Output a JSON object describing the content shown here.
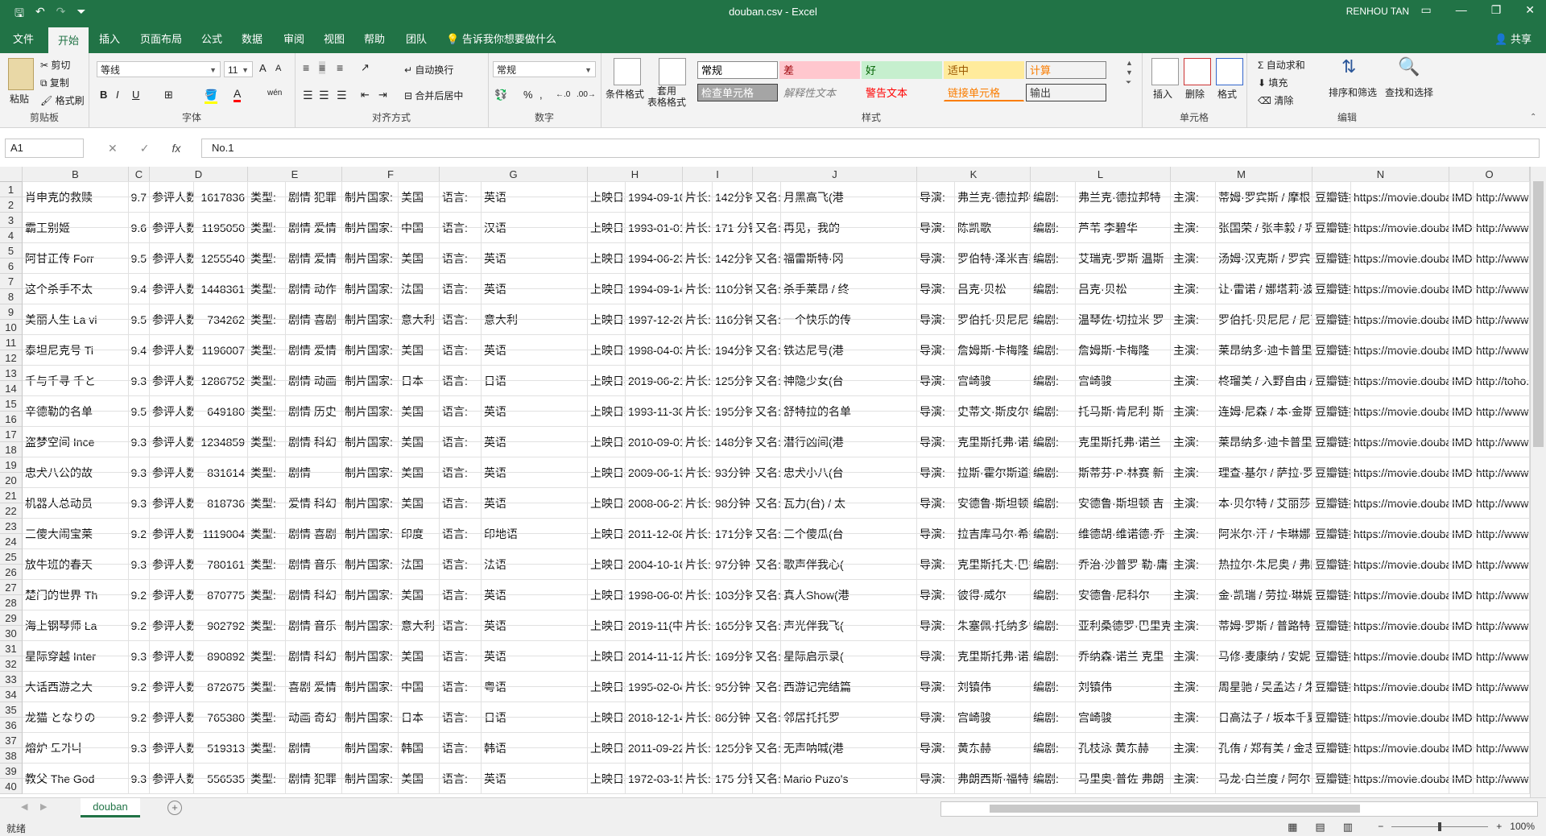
{
  "window": {
    "title": "douban.csv - Excel",
    "user": "RENHOU TAN",
    "share_label": "共享",
    "qat": {
      "save_icon": "save-icon",
      "undo_icon": "undo-icon",
      "redo_icon": "redo-icon",
      "customize_icon": "customize-icon"
    }
  },
  "tabs": [
    "文件",
    "开始",
    "插入",
    "页面布局",
    "公式",
    "数据",
    "审阅",
    "视图",
    "帮助",
    "团队"
  ],
  "active_tab": "开始",
  "tell_me": "告诉我你想要做什么",
  "ribbon": {
    "clipboard": {
      "paste": "粘贴",
      "cut": "剪切",
      "copy": "复制",
      "format_painter": "格式刷",
      "label": "剪贴板"
    },
    "font": {
      "name": "等线",
      "size": "11",
      "bold": "B",
      "italic": "I",
      "underline": "U",
      "grow": "A",
      "shrink": "A",
      "font_color": "A",
      "phonetic": "wén",
      "label": "字体"
    },
    "alignment": {
      "wrap": "自动换行",
      "merge": "合并后居中",
      "label": "对齐方式"
    },
    "number": {
      "format": "常规",
      "percent": "%",
      "comma": ",",
      "label": "数字"
    },
    "styles": {
      "conditional": "条件格式",
      "table": "套用\n表格格式",
      "cells": [
        {
          "text": "常规",
          "bg": "#ffffff",
          "color": "#000000",
          "border": "#888888"
        },
        {
          "text": "差",
          "bg": "#ffc7ce",
          "color": "#9c0006",
          "border": "#ffc7ce"
        },
        {
          "text": "好",
          "bg": "#c6efce",
          "color": "#006100",
          "border": "#c6efce"
        },
        {
          "text": "适中",
          "bg": "#ffeb9c",
          "color": "#9c5700",
          "border": "#ffeb9c"
        },
        {
          "text": "计算",
          "bg": "#f2f2f2",
          "color": "#fa7d00",
          "border": "#7f7f7f"
        },
        {
          "text": "检查单元格",
          "bg": "#a5a5a5",
          "color": "#ffffff",
          "border": "#3f3f3f"
        },
        {
          "text": "解释性文本",
          "bg": "#f3f3f3",
          "color": "#7f7f7f",
          "border": "#f3f3f3"
        },
        {
          "text": "警告文本",
          "bg": "#f3f3f3",
          "color": "#ff0000",
          "border": "#f3f3f3"
        },
        {
          "text": "链接单元格",
          "bg": "#f3f3f3",
          "color": "#fa7d00",
          "border": "#f3f3f3"
        },
        {
          "text": "输出",
          "bg": "#f2f2f2",
          "color": "#3f3f3f",
          "border": "#3f3f3f"
        }
      ],
      "label": "样式"
    },
    "cells_group": {
      "insert": "插入",
      "delete": "删除",
      "format": "格式",
      "label": "单元格"
    },
    "editing": {
      "autosum": "自动求和",
      "fill": "填充",
      "clear": "清除",
      "sort": "排序和筛选",
      "find": "查找和选择",
      "label": "编辑"
    }
  },
  "formula_bar": {
    "name_box": "A1",
    "cancel": "✕",
    "enter": "✓",
    "fx": "fx",
    "content": "No.1"
  },
  "columns": [
    "B",
    "C",
    "D",
    "E",
    "F",
    "G",
    "H",
    "I",
    "J",
    "K",
    "L",
    "M",
    "N",
    "O"
  ],
  "rows": [
    [
      "肖申克的救赎",
      "9.7",
      "参评人数:",
      "1617836",
      "类型:",
      "剧情 犯罪",
      "制片国家:",
      "美国",
      "语言:",
      "英语",
      "上映日期:",
      "1994-09-10",
      "片长:",
      "142分钟",
      "又名:",
      "月黑高飞(港",
      "导演:",
      "弗兰克·德拉邦特",
      "编剧:",
      "弗兰克·德拉邦特",
      "主演:",
      "蒂姆·罗宾斯 / 摩根·弗里",
      "豆瓣链接:",
      "https://movie.douban",
      "IMDb链接:",
      "http://www.imdb.c"
    ],
    [
      "霸王别姬",
      "9.6",
      "参评人数:",
      "1195050",
      "类型:",
      "剧情 爱情",
      "制片国家:",
      "中国",
      "语言:",
      "汉语",
      "上映日期:",
      "1993-01-01",
      "片长:",
      "171 分钟",
      "又名:",
      "再见，我的",
      "导演:",
      "陈凯歌",
      "编剧:",
      "芦苇 李碧华",
      "主演:",
      "张国荣 / 张丰毅 / 巩俐",
      "豆瓣链接:",
      "https://movie.douban",
      "IMDb链接:",
      "http://www.imdb.c"
    ],
    [
      "阿甘正传 Forr",
      "9.5",
      "参评人数:",
      "1255540",
      "类型:",
      "剧情 爱情",
      "制片国家:",
      "美国",
      "语言:",
      "英语",
      "上映日期:",
      "1994-06-23",
      "片长:",
      "142分钟",
      "又名:",
      "福雷斯特·冈",
      "导演:",
      "罗伯特·泽米吉斯",
      "编剧:",
      "艾瑞克·罗斯 温斯",
      "主演:",
      "汤姆·汉克斯 / 罗宾·怀特",
      "豆瓣链接:",
      "https://movie.douban",
      "IMDb链接:",
      "http://www.imdb.c"
    ],
    [
      "这个杀手不太",
      "9.4",
      "参评人数:",
      "1448361",
      "类型:",
      "剧情 动作",
      "制片国家:",
      "法国",
      "语言:",
      "英语",
      "上映日期:",
      "1994-09-14",
      "片长:",
      "110分钟",
      "又名:",
      "杀手莱昂 / 终",
      "导演:",
      "吕克·贝松",
      "编剧:",
      "吕克·贝松",
      "主演:",
      "让·雷诺 / 娜塔莉·波特曼",
      "豆瓣链接:",
      "https://movie.douban",
      "IMDb链接:",
      "http://www.imdb.c"
    ],
    [
      "美丽人生 La vi",
      "9.5",
      "参评人数:",
      "734262",
      "类型:",
      "剧情 喜剧",
      "制片国家:",
      "意大利",
      "语言:",
      "意大利",
      "上映日期:",
      "1997-12-20",
      "片长:",
      "116分钟",
      "又名:",
      "一个快乐的传",
      "导演:",
      "罗伯托·贝尼尼",
      "编剧:",
      "温琴佐·切拉米 罗",
      "主演:",
      "罗伯托·贝尼尼 / 尼可莱",
      "豆瓣链接:",
      "https://movie.douban",
      "IMDb链接:",
      "http://www.imdb.c"
    ],
    [
      "泰坦尼克号 Ti",
      "9.4",
      "参评人数:",
      "1196007",
      "类型:",
      "剧情 爱情",
      "制片国家:",
      "美国",
      "语言:",
      "英语",
      "上映日期:",
      "1998-04-03",
      "片长:",
      "194分钟",
      "又名:",
      "铁达尼号(港",
      "导演:",
      "詹姆斯·卡梅隆",
      "编剧:",
      "詹姆斯·卡梅隆",
      "主演:",
      "莱昂纳多·迪卡普里奥 /",
      "豆瓣链接:",
      "https://movie.douban",
      "IMDb链接:",
      "http://www.imdb.c"
    ],
    [
      "千与千寻 千と",
      "9.3",
      "参评人数:",
      "1286752",
      "类型:",
      "剧情 动画",
      "制片国家:",
      "日本",
      "语言:",
      "日语",
      "上映日期:",
      "2019-06-21",
      "片长:",
      "125分钟",
      "又名:",
      "神隐少女(台",
      "导演:",
      "宫崎骏",
      "编剧:",
      "宫崎骏",
      "主演:",
      "柊瑠美 / 入野自由 / 夏",
      "豆瓣链接:",
      "https://movie.douban",
      "IMDb链接:",
      "http://toho.co.jp/s"
    ],
    [
      "辛德勒的名单",
      "9.5",
      "参评人数:",
      "649180",
      "类型:",
      "剧情 历史",
      "制片国家:",
      "美国",
      "语言:",
      "英语",
      "上映日期:",
      "1993-11-30",
      "片长:",
      "195分钟",
      "又名:",
      "舒特拉的名单",
      "导演:",
      "史蒂文·斯皮尔伯",
      "编剧:",
      "托马斯·肯尼利 斯",
      "主演:",
      "连姆·尼森 / 本·金斯利 /",
      "豆瓣链接:",
      "https://movie.douban",
      "IMDb链接:",
      "http://www.imdb.c"
    ],
    [
      "盗梦空间 Ince",
      "9.3",
      "参评人数:",
      "1234859",
      "类型:",
      "剧情 科幻",
      "制片国家:",
      "美国",
      "语言:",
      "英语",
      "上映日期:",
      "2010-09-01",
      "片长:",
      "148分钟",
      "又名:",
      "潜行凶间(港",
      "导演:",
      "克里斯托弗·诺兰",
      "编剧:",
      "克里斯托弗·诺兰",
      "主演:",
      "莱昂纳多·迪卡普里奥 /",
      "豆瓣链接:",
      "https://movie.douban",
      "IMDb链接:",
      "http://www.imdb.c"
    ],
    [
      "忠犬八公的故",
      "9.3",
      "参评人数:",
      "831614",
      "类型:",
      "剧情",
      "制片国家:",
      "美国",
      "语言:",
      "英语",
      "上映日期:",
      "2009-06-13",
      "片长:",
      "93分钟",
      "又名:",
      "忠犬小八(台",
      "导演:",
      "拉斯·霍尔斯道姆",
      "编剧:",
      "斯蒂芬·P·林赛 新",
      "主演:",
      "理查·基尔 / 萨拉·罗默尔",
      "豆瓣链接:",
      "https://movie.douban",
      "IMDb链接:",
      "http://www.imdb.c"
    ],
    [
      "机器人总动员",
      "9.3",
      "参评人数:",
      "818736",
      "类型:",
      "爱情 科幻",
      "制片国家:",
      "美国",
      "语言:",
      "英语",
      "上映日期:",
      "2008-06-27",
      "片长:",
      "98分钟",
      "又名:",
      "瓦力(台) / 太",
      "导演:",
      "安德鲁·斯坦顿",
      "编剧:",
      "安德鲁·斯坦顿 吉",
      "主演:",
      "本·贝尔特 / 艾丽莎·奈特",
      "豆瓣链接:",
      "https://movie.douban",
      "IMDb链接:",
      "http://www.pixar.c"
    ],
    [
      "三傻大闹宝莱",
      "9.2",
      "参评人数:",
      "1119004",
      "类型:",
      "剧情 喜剧",
      "制片国家:",
      "印度",
      "语言:",
      "印地语",
      "上映日期:",
      "2011-12-08",
      "片长:",
      "171分钟",
      "又名:",
      "三个傻瓜(台",
      "导演:",
      "拉吉库马尔·希拉",
      "编剧:",
      "维德胡·维诺德·乔",
      "主演:",
      "阿米尔·汗 / 卡琳娜·卡普",
      "豆瓣链接:",
      "https://movie.douban",
      "IMDb链接:",
      "http://www.imdb.c"
    ],
    [
      "放牛班的春天",
      "9.3",
      "参评人数:",
      "780161",
      "类型:",
      "剧情 音乐",
      "制片国家:",
      "法国",
      "语言:",
      "法语",
      "上映日期:",
      "2004-10-16",
      "片长:",
      "97分钟",
      "又名:",
      "歌声伴我心(",
      "导演:",
      "克里斯托夫·巴拉",
      "编剧:",
      "乔治·沙普罗 勒·庸",
      "主演:",
      "热拉尔·朱尼奥 / 弗朗索",
      "豆瓣链接:",
      "https://movie.douban",
      "IMDb链接:",
      "http://www.imdb.c"
    ],
    [
      "楚门的世界 Th",
      "9.2",
      "参评人数:",
      "870775",
      "类型:",
      "剧情 科幻",
      "制片国家:",
      "美国",
      "语言:",
      "英语",
      "上映日期:",
      "1998-06-05",
      "片长:",
      "103分钟",
      "又名:",
      "真人Show(港",
      "导演:",
      "彼得·威尔",
      "编剧:",
      "安德鲁·尼科尔",
      "主演:",
      "金·凯瑞 / 劳拉·琳妮 / 艾",
      "豆瓣链接:",
      "https://movie.douban",
      "IMDb链接:",
      "http://www.imdb.c"
    ],
    [
      "海上钢琴师 La",
      "9.2",
      "参评人数:",
      "902792",
      "类型:",
      "剧情 音乐",
      "制片国家:",
      "意大利",
      "语言:",
      "英语",
      "上映日期:",
      "2019-11(中国",
      "片长:",
      "165分钟",
      "又名:",
      "声光伴我飞(",
      "导演:",
      "朱塞佩·托纳多雷",
      "编剧:",
      "亚利桑德罗·巴里克",
      "主演:",
      "蒂姆·罗斯 / 普路特·泰勒",
      "豆瓣链接:",
      "https://movie.douban",
      "IMDb链接:",
      "http://www.imdb.c"
    ],
    [
      "星际穿越 Inter",
      "9.3",
      "参评人数:",
      "890892",
      "类型:",
      "剧情 科幻",
      "制片国家:",
      "美国",
      "语言:",
      "英语",
      "上映日期:",
      "2014-11-12",
      "片长:",
      "169分钟",
      "又名:",
      "星际启示录(",
      "导演:",
      "克里斯托弗·诺兰",
      "编剧:",
      "乔纳森·诺兰 克里",
      "主演:",
      "马修·麦康纳 / 安妮·海瑟",
      "豆瓣链接:",
      "https://movie.douban",
      "IMDb链接:",
      "http://www.imdb.c"
    ],
    [
      "大话西游之大",
      "9.2",
      "参评人数:",
      "872675",
      "类型:",
      "喜剧 爱情",
      "制片国家:",
      "中国",
      "语言:",
      "粤语",
      "上映日期:",
      "1995-02-04",
      "片长:",
      "95分钟",
      "又名:",
      "西游记完结篇",
      "导演:",
      "刘镇伟",
      "编剧:",
      "刘镇伟",
      "主演:",
      "周星驰 / 吴孟达 / 朱茵 /",
      "豆瓣链接:",
      "https://movie.douban",
      "IMDb链接:",
      "http://www.imdb.c"
    ],
    [
      "龙猫 となりの",
      "9.2",
      "参评人数:",
      "765380",
      "类型:",
      "动画 奇幻",
      "制片国家:",
      "日本",
      "语言:",
      "日语",
      "上映日期:",
      "2018-12-14",
      "片长:",
      "86分钟",
      "又名:",
      "邻居托托罗",
      "导演:",
      "宫崎骏",
      "编剧:",
      "宫崎骏",
      "主演:",
      "日高法子 / 坂本千夏 /",
      "豆瓣链接:",
      "https://movie.douban",
      "IMDb链接:",
      "http://www.imdb.c"
    ],
    [
      "熔炉 도가니",
      "9.3",
      "参评人数:",
      "519313",
      "类型:",
      "剧情",
      "制片国家:",
      "韩国",
      "语言:",
      "韩语",
      "上映日期:",
      "2011-09-22",
      "片长:",
      "125分钟",
      "又名:",
      "无声呐喊(港",
      "导演:",
      "黄东赫",
      "编剧:",
      "孔枝泳 黄东赫",
      "主演:",
      "孔侑 / 郑有美 / 金志映 /",
      "豆瓣链接:",
      "https://movie.douban",
      "IMDb链接:",
      "http://www.imdb.c"
    ],
    [
      "教父 The God",
      "9.3",
      "参评人数:",
      "556535",
      "类型:",
      "剧情 犯罪",
      "制片国家:",
      "美国",
      "语言:",
      "英语",
      "上映日期:",
      "1972-03-15",
      "片长:",
      "175 分钟",
      "又名:",
      "Mario Puzo's",
      "导演:",
      "弗朗西斯·福特·科",
      "编剧:",
      "马里奥·普佐 弗朗",
      "主演:",
      "马龙·白兰度 / 阿尔·帕西",
      "豆瓣链接:",
      "https://movie.douban",
      "IMDb链接:",
      "http://www.imdb.c"
    ]
  ],
  "row_numbers": [
    "1",
    "2",
    "3",
    "4",
    "5",
    "6",
    "7",
    "8",
    "9",
    "10",
    "11",
    "12",
    "13",
    "14",
    "15",
    "16",
    "17",
    "18",
    "19",
    "20",
    "21",
    "22",
    "23",
    "24",
    "25",
    "26",
    "27",
    "28",
    "29",
    "30",
    "31",
    "32",
    "33",
    "34",
    "35",
    "36",
    "37",
    "38",
    "39",
    "40"
  ],
  "sheet": {
    "name": "douban",
    "add_icon": "plus-icon"
  },
  "status": {
    "text": "就绪",
    "zoom": "100%",
    "zoom_minus": "−",
    "zoom_plus": "+"
  }
}
